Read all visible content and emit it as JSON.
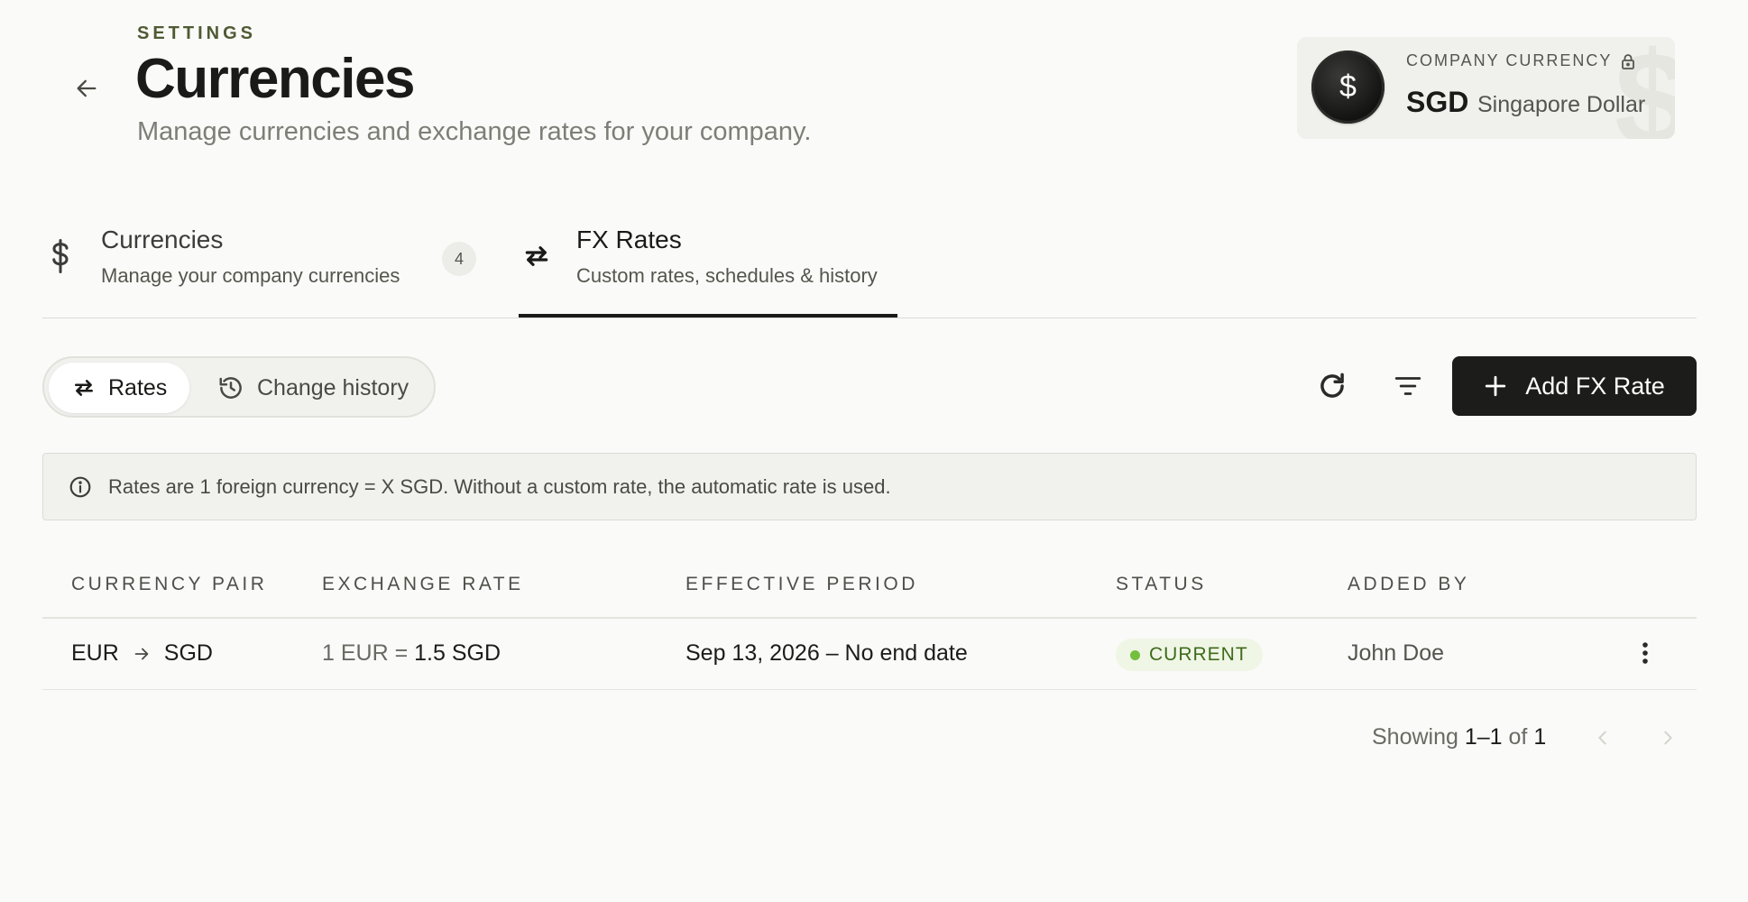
{
  "header": {
    "eyebrow": "SETTINGS",
    "title": "Currencies",
    "subtitle": "Manage currencies and exchange rates for your company."
  },
  "company_currency": {
    "label": "COMPANY CURRENCY",
    "symbol": "$",
    "code": "SGD",
    "name": "Singapore Dollar",
    "watermark": "$",
    "lock_icon": "lock-icon"
  },
  "tabs": [
    {
      "title": "Currencies",
      "description": "Manage your company currencies",
      "count": "4",
      "icon": "dollar-icon"
    },
    {
      "title": "FX Rates",
      "description": "Custom rates, schedules & history",
      "icon": "swap-arrows-icon",
      "active": true
    }
  ],
  "segments": {
    "rates": "Rates",
    "history": "Change history"
  },
  "toolbar": {
    "add_label": "Add FX Rate"
  },
  "banner": {
    "text": "Rates are 1 foreign currency = X SGD. Without a custom rate, the automatic rate is used."
  },
  "table": {
    "columns": [
      "CURRENCY PAIR",
      "EXCHANGE RATE",
      "EFFECTIVE PERIOD",
      "STATUS",
      "ADDED BY"
    ],
    "rows": [
      {
        "from": "EUR",
        "to": "SGD",
        "rate_prefix": "1 EUR = ",
        "rate_value": "1.5 SGD",
        "period": "Sep 13, 2026 – No end date",
        "status": "CURRENT",
        "added_by": "John Doe"
      }
    ]
  },
  "pagination": {
    "prefix": "Showing ",
    "range": "1–1",
    "of": " of ",
    "total": "1"
  },
  "colors": {
    "background": "#fafaf8",
    "primary_button": "#1c1c1a",
    "eyebrow": "#4f5a33",
    "status_current": "#74bf3e"
  }
}
